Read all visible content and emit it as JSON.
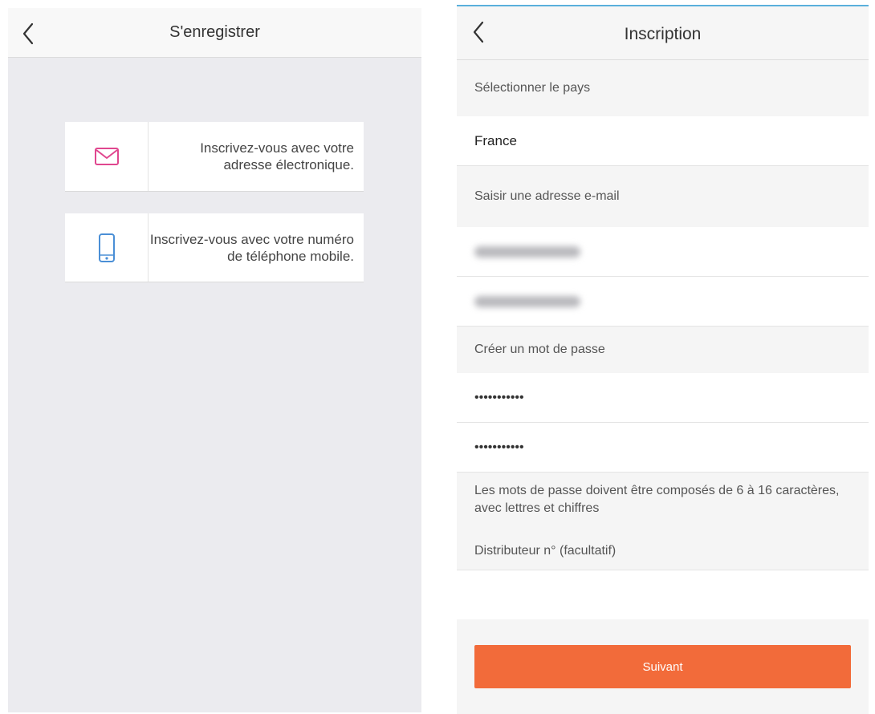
{
  "left_screen": {
    "header": {
      "title": "S'enregistrer"
    },
    "options": [
      {
        "icon": "envelope-icon",
        "label": "Inscrivez-vous avec votre adresse électronique."
      },
      {
        "icon": "smartphone-icon",
        "label": "Inscrivez-vous avec votre numéro de téléphone mobile."
      }
    ]
  },
  "right_screen": {
    "header": {
      "title": "Inscription"
    },
    "country": {
      "label": "Sélectionner le pays",
      "value": "France"
    },
    "email": {
      "label": "Saisir une adresse e-mail"
    },
    "password": {
      "label": "Créer un mot de passe",
      "value": "•••••••••••",
      "confirm_value": "•••••••••••",
      "hint": "Les mots de passe doivent être composés de 6 à 16 caractères, avec lettres et chiffres"
    },
    "distributor": {
      "label": "Distributeur n° (facultatif)"
    },
    "next_button": {
      "label": "Suivant"
    }
  },
  "colors": {
    "accent": "#f26b3a",
    "email_icon": "#e0478f",
    "phone_icon": "#4a8fd6",
    "top_border": "#5ab0dc"
  }
}
